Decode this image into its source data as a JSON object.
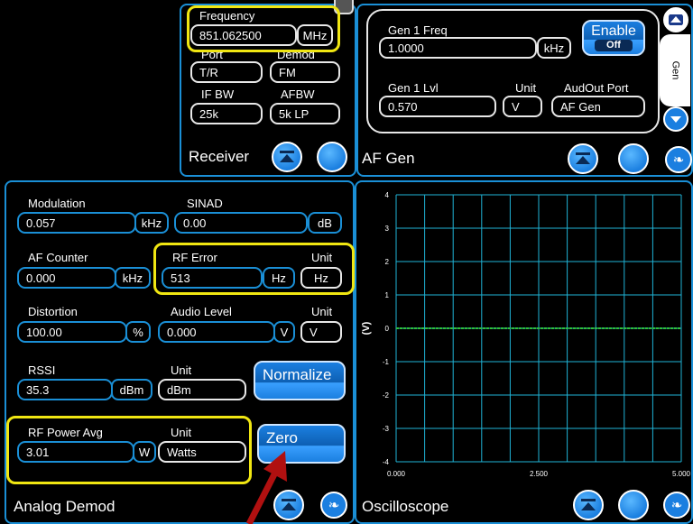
{
  "receiver": {
    "title": "Receiver",
    "frequency_label": "Frequency",
    "frequency_value": "851.062500",
    "frequency_unit": "MHz",
    "port_label": "Port",
    "port_value": "T/R",
    "demod_label": "Demod",
    "demod_value": "FM",
    "ifbw_label": "IF BW",
    "ifbw_value": "25k",
    "afbw_label": "AFBW",
    "afbw_value": "5k LP"
  },
  "afgen": {
    "title": "AF Gen",
    "gen1freq_label": "Gen 1 Freq",
    "gen1freq_value": "1.0000",
    "gen1freq_unit": "kHz",
    "enable_label": "Enable",
    "enable_state": "Off",
    "gen1lvl_label": "Gen 1 Lvl",
    "gen1lvl_value": "0.570",
    "unit_label": "Unit",
    "unit_value": "V",
    "audout_label": "AudOut Port",
    "audout_value": "AF Gen",
    "side_tab": "Gen"
  },
  "analog_demod": {
    "title": "Analog Demod",
    "modulation_label": "Modulation",
    "modulation_value": "0.057",
    "modulation_unit": "kHz",
    "sinad_label": "SINAD",
    "sinad_value": "0.00",
    "sinad_unit": "dB",
    "afcounter_label": "AF Counter",
    "afcounter_value": "0.000",
    "afcounter_unit": "kHz",
    "rferror_label": "RF Error",
    "rferror_value": "513",
    "rferror_unit": "Hz",
    "rferror_unit_label": "Unit",
    "rferror_unit_value": "Hz",
    "distortion_label": "Distortion",
    "distortion_value": "100.00",
    "distortion_unit": "%",
    "audiolevel_label": "Audio Level",
    "audiolevel_value": "0.000",
    "audiolevel_unit": "V",
    "audiolevel_unit_label": "Unit",
    "audiolevel_unit_value": "V",
    "rssi_label": "RSSI",
    "rssi_value": "35.3",
    "rssi_unit": "dBm",
    "rssi_unit_label": "Unit",
    "rssi_unit_value": "dBm",
    "normalize_label": "Normalize",
    "rfpower_label": "RF Power Avg",
    "rfpower_value": "3.01",
    "rfpower_unit": "W",
    "rfpower_unit_label": "Unit",
    "rfpower_unit_value": "Watts",
    "zero_label": "Zero"
  },
  "oscilloscope": {
    "title": "Oscilloscope",
    "ylabel": "(V)",
    "yticks": [
      "4",
      "3",
      "2",
      "1",
      "0",
      "-1",
      "-2",
      "-3",
      "-4"
    ],
    "xticks": [
      "0.000",
      "2.500",
      "5.000"
    ]
  },
  "chart_data": {
    "type": "line",
    "title": "",
    "xlabel": "",
    "ylabel": "(V)",
    "xlim": [
      0,
      5
    ],
    "ylim": [
      -4,
      4
    ],
    "grid": true,
    "series": [
      {
        "x": [
          0,
          5
        ],
        "y": [
          0,
          0
        ],
        "color": "#2fbf3a"
      }
    ]
  },
  "colors": {
    "accent": "#1a8fd6",
    "highlight": "#f0e612",
    "grid": "#1fb3d6",
    "trace": "#2fbf3a"
  }
}
